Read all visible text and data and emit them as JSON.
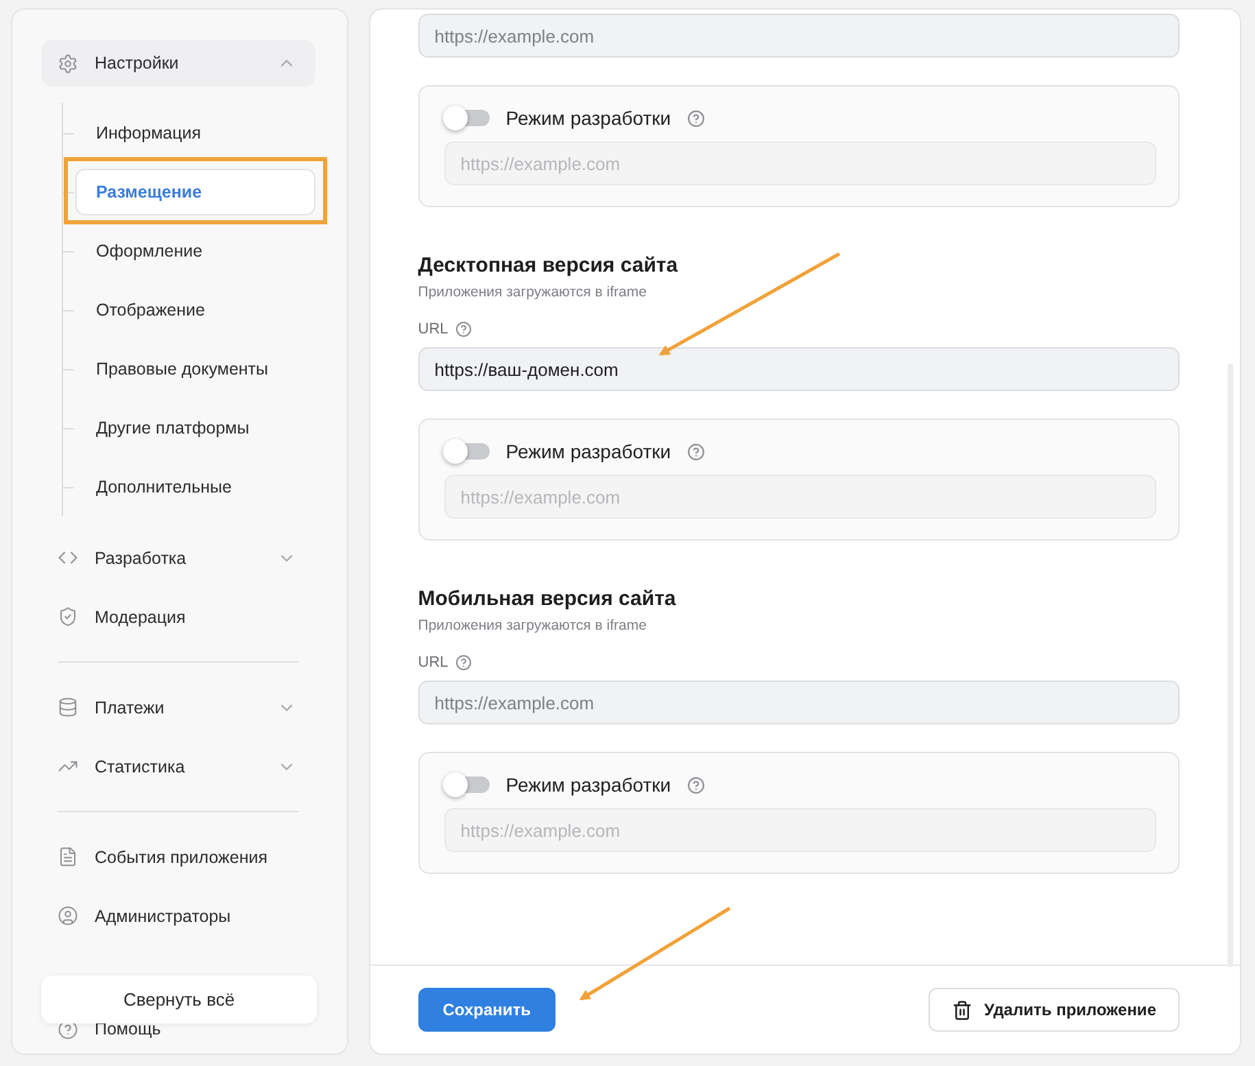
{
  "sidebar": {
    "groups": [
      {
        "items": [
          {
            "label": "Настройки",
            "expanded": true,
            "children": [
              {
                "label": "Информация",
                "selected": false
              },
              {
                "label": "Размещение",
                "selected": true
              },
              {
                "label": "Оформление",
                "selected": false
              },
              {
                "label": "Отображение",
                "selected": false
              },
              {
                "label": "Правовые документы",
                "selected": false
              },
              {
                "label": "Другие платформы",
                "selected": false
              },
              {
                "label": "Дополнительные",
                "selected": false
              }
            ]
          },
          {
            "label": "Разработка",
            "expanded": false
          },
          {
            "label": "Модерация"
          }
        ]
      },
      {
        "items": [
          {
            "label": "Платежи",
            "expanded": false
          },
          {
            "label": "Статистика",
            "expanded": false
          }
        ]
      },
      {
        "items": [
          {
            "label": "События приложения"
          },
          {
            "label": "Администраторы"
          }
        ]
      }
    ],
    "help": {
      "label": "Помощь"
    },
    "collapse_button": "Свернуть всё"
  },
  "sections": [
    {
      "url": {
        "placeholder": "https://example.com"
      },
      "dev": {
        "label": "Режим разработки",
        "on": false,
        "field": {
          "placeholder": "https://example.com",
          "disabled": true
        }
      }
    },
    {
      "title": "Десктопная версия сайта",
      "subtitle": "Приложения загружаются в iframe",
      "url_label": "URL",
      "url": {
        "value": "https://ваш-домен.com"
      },
      "dev": {
        "label": "Режим разработки",
        "on": false,
        "field": {
          "placeholder": "https://example.com",
          "disabled": true
        }
      }
    },
    {
      "title": "Мобильная версия сайта",
      "subtitle": "Приложения загружаются в iframe",
      "url_label": "URL",
      "url": {
        "placeholder": "https://example.com"
      },
      "dev": {
        "label": "Режим разработки",
        "on": false,
        "field": {
          "placeholder": "https://example.com",
          "disabled": true
        }
      }
    }
  ],
  "footer": {
    "save": "Сохранить",
    "delete": "Удалить приложение"
  }
}
